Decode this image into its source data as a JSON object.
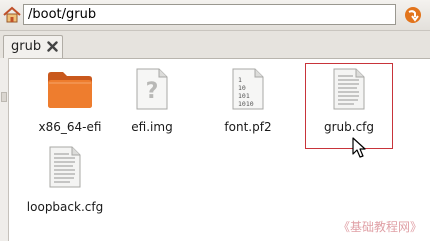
{
  "location": {
    "path": "/boot/grub"
  },
  "tabs": [
    {
      "label": "grub"
    }
  ],
  "files": [
    {
      "name": "x86_64-efi",
      "icon": "folder-icon"
    },
    {
      "name": "efi.img",
      "icon": "unknown-file-icon"
    },
    {
      "name": "font.pf2",
      "icon": "binary-file-icon"
    },
    {
      "name": "grub.cfg",
      "icon": "text-file-icon",
      "selected": true
    },
    {
      "name": "loopback.cfg",
      "icon": "text-file-icon"
    }
  ],
  "binary_icon_text": [
    "1",
    "10",
    "101",
    "1010"
  ],
  "unknown_icon_glyph": "?",
  "watermark": "《基础教程网》",
  "colors": {
    "folder": "#e8742a",
    "selection": "#c8343a",
    "go_arrow": "#e2741c"
  }
}
